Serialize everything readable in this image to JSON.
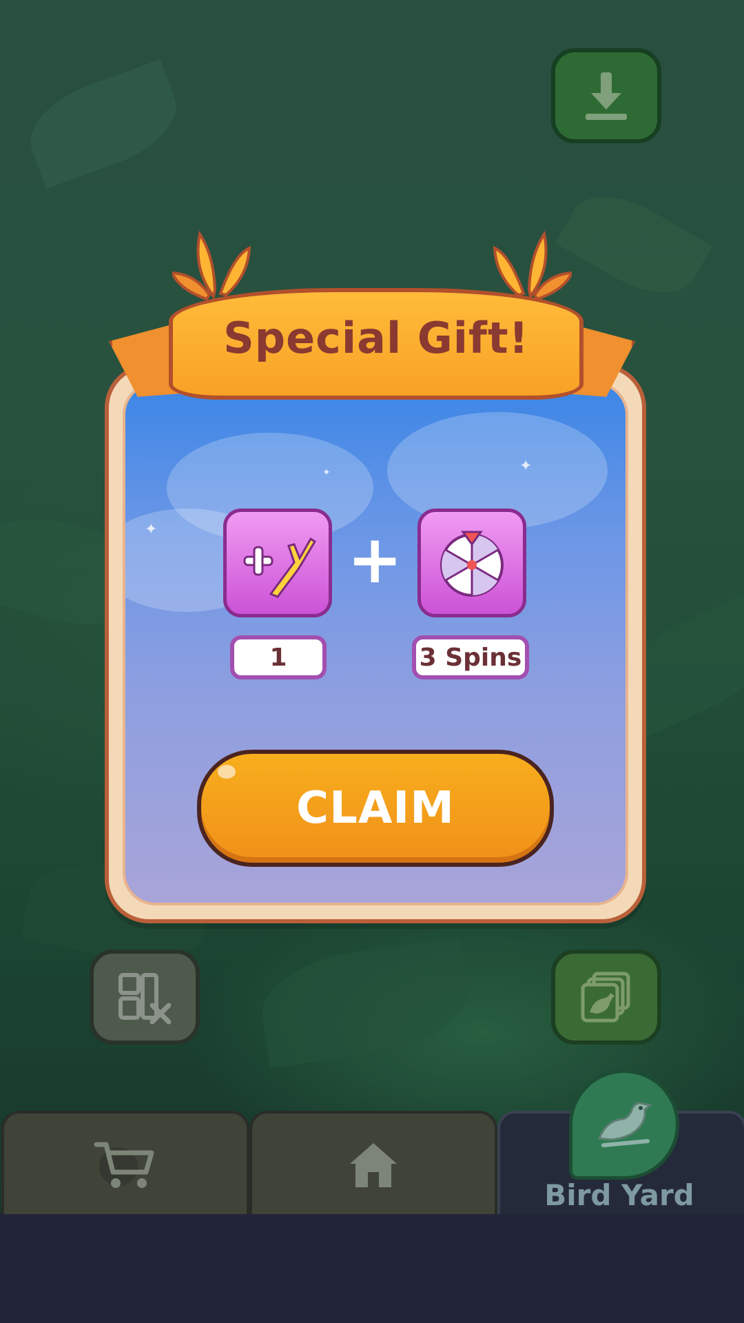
{
  "dialog": {
    "title": "Special Gift!",
    "rewards": [
      {
        "icon": "branch-plus-icon",
        "amount": "1"
      },
      {
        "icon": "spin-wheel-icon",
        "amount": "3 Spins"
      }
    ],
    "separator": "+",
    "claim_label": "CLAIM"
  },
  "tabs": {
    "shop_icon": "cart-icon",
    "home_icon": "home-icon",
    "yard_icon": "bird-icon",
    "yard_label": "Bird Yard"
  },
  "buttons": {
    "download_icon": "download-icon",
    "gallery_icon": "bird-gallery-icon",
    "layout_icon": "layout-close-icon"
  },
  "colors": {
    "claim": "#f7a51c",
    "reward_tile": "#d466dc",
    "ribbon": "#ffb534",
    "title_text": "#8a3a30"
  }
}
